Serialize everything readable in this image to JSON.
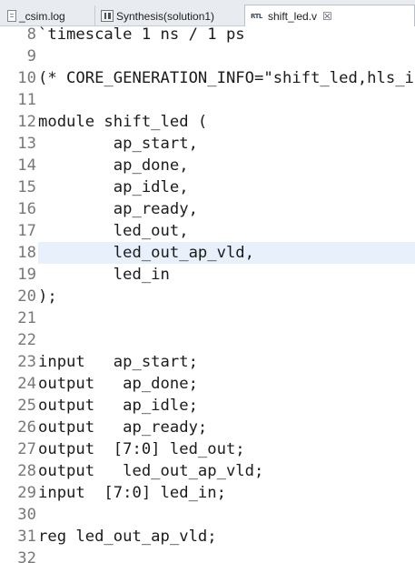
{
  "tabs": [
    {
      "id": "log",
      "label": "_csim.log",
      "icon": "document-icon"
    },
    {
      "id": "syn",
      "label": "Synthesis(solution1)",
      "icon": "synthesis-report-icon"
    },
    {
      "id": "src",
      "label": "shift_led.v",
      "icon": "rtl-file-icon",
      "icon_text": "RTL",
      "close": "☒",
      "active": true
    }
  ],
  "editor": {
    "current_line": 18,
    "lines": [
      {
        "n": "8",
        "text": "`timescale 1 ns / 1 ps"
      },
      {
        "n": "9",
        "text": ""
      },
      {
        "n": "10",
        "text": "(* CORE_GENERATION_INFO=\"shift_led,hls_i"
      },
      {
        "n": "11",
        "text": ""
      },
      {
        "n": "12",
        "text": "module shift_led ("
      },
      {
        "n": "13",
        "text": "        ap_start,"
      },
      {
        "n": "14",
        "text": "        ap_done,"
      },
      {
        "n": "15",
        "text": "        ap_idle,"
      },
      {
        "n": "16",
        "text": "        ap_ready,"
      },
      {
        "n": "17",
        "text": "        led_out,"
      },
      {
        "n": "18",
        "text": "        led_out_ap_vld,"
      },
      {
        "n": "19",
        "text": "        led_in"
      },
      {
        "n": "20",
        "text": ");"
      },
      {
        "n": "21",
        "text": ""
      },
      {
        "n": "22",
        "text": ""
      },
      {
        "n": "23",
        "text": "input   ap_start;"
      },
      {
        "n": "24",
        "text": "output   ap_done;"
      },
      {
        "n": "25",
        "text": "output   ap_idle;"
      },
      {
        "n": "26",
        "text": "output   ap_ready;"
      },
      {
        "n": "27",
        "text": "output  [7:0] led_out;"
      },
      {
        "n": "28",
        "text": "output   led_out_ap_vld;"
      },
      {
        "n": "29",
        "text": "input  [7:0] led_in;"
      },
      {
        "n": "30",
        "text": ""
      },
      {
        "n": "31",
        "text": "reg led_out_ap_vld;"
      },
      {
        "n": "32",
        "text": ""
      }
    ]
  }
}
